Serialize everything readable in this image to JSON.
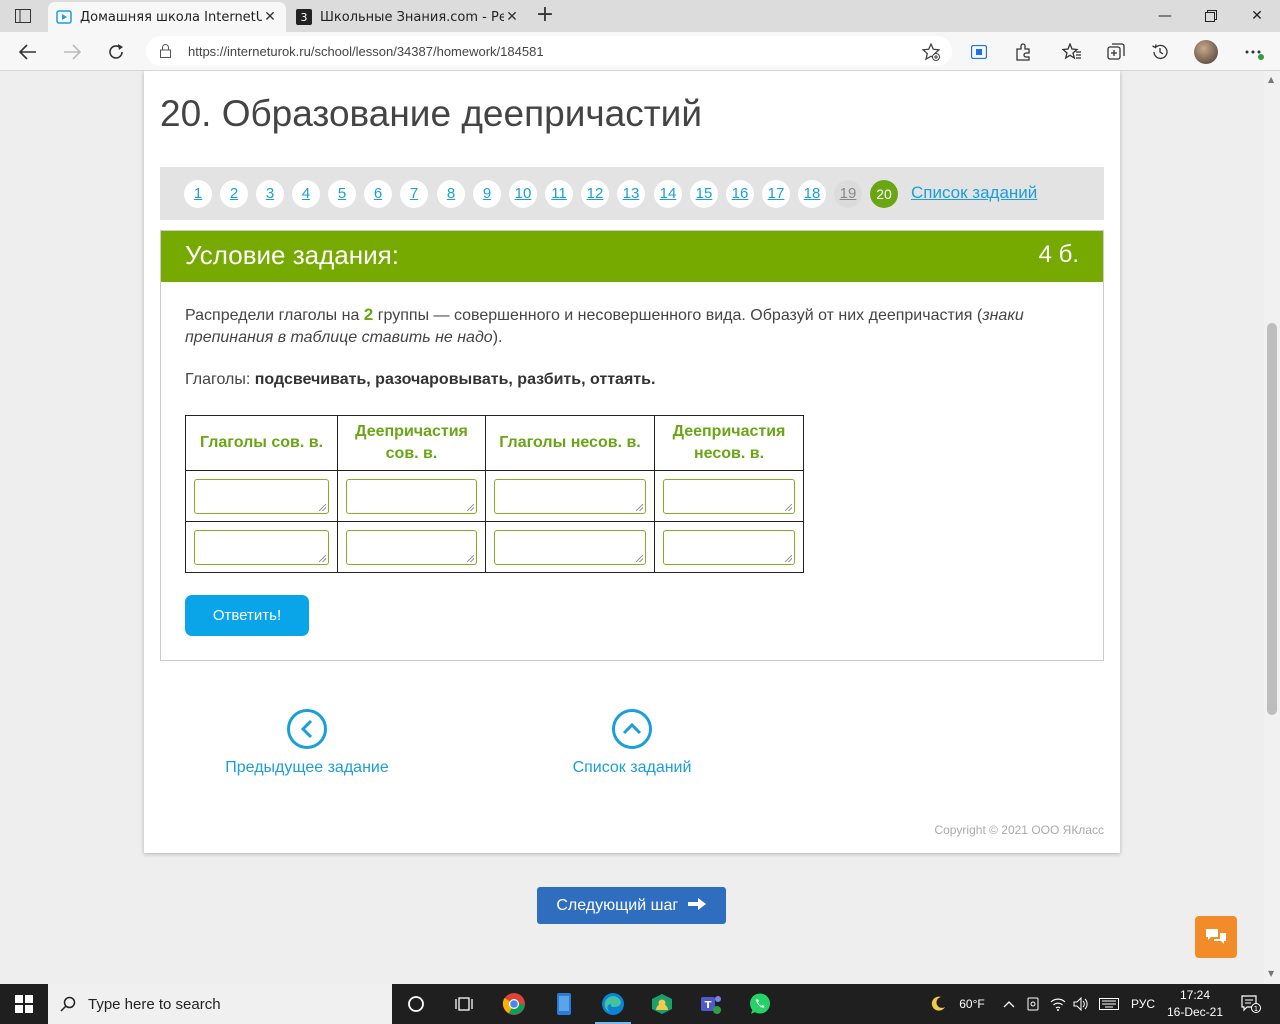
{
  "browser": {
    "tabs": [
      {
        "title": "Домашняя школа InternetUrok.r",
        "active": true
      },
      {
        "title": "Школьные Знания.com - Решае",
        "active": false
      }
    ],
    "url": "https://interneturok.ru/school/lesson/34387/homework/184581"
  },
  "lesson": {
    "title": "20. Образование деепричастий"
  },
  "task_nav": {
    "numbers": [
      "1",
      "2",
      "3",
      "4",
      "5",
      "6",
      "7",
      "8",
      "9",
      "10",
      "11",
      "12",
      "13",
      "14",
      "15",
      "16",
      "17",
      "18",
      "19",
      "20"
    ],
    "visited": "19",
    "current": "20",
    "list_link": "Список заданий"
  },
  "condition": {
    "header": "Условие задания:",
    "points": "4 б.",
    "text_part1": "Распредели глаголы на ",
    "text_highlight": "2",
    "text_part2": " группы — совершенного и несовершенного вида. Образуй от них деепричастия (",
    "text_italic": "знаки препинания в таблице ставить не надо",
    "text_part3": ").",
    "verbs_label": "Глаголы: ",
    "verbs_list": "подсвечивать, разочаровывать, разбить, оттаять."
  },
  "table": {
    "headers": [
      "Глаголы сов. в.",
      "Деепричастия сов. в.",
      "Глаголы несов. в.",
      "Деепричастия несов. в."
    ],
    "rows": [
      [
        "",
        "",
        "",
        ""
      ],
      [
        "",
        "",
        "",
        ""
      ]
    ]
  },
  "submit_label": "Ответить!",
  "bottom_nav": {
    "prev": "Предыдущее задание",
    "list": "Список заданий"
  },
  "copyright": "Copyright © 2021 ООО ЯКласс",
  "next_step": "Следующий шаг",
  "taskbar": {
    "search_placeholder": "Type here to search",
    "weather": "60°F",
    "lang": "РУС",
    "time": "17:24",
    "date": "16-Dec-21",
    "notifications": "1"
  },
  "colors": {
    "accent_green": "#76aa00",
    "link_blue": "#1a9fd8",
    "submit_blue": "#0aa5e8",
    "next_blue": "#2f6ebf",
    "chat_orange": "#f28c28"
  }
}
